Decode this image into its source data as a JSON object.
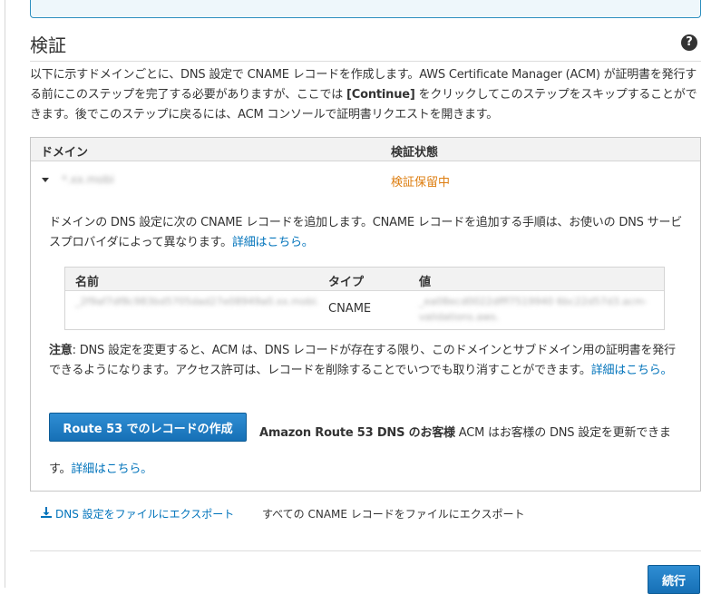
{
  "section": {
    "title": "検証",
    "help_icon": "question-circle-icon",
    "intro_part1": "以下に示すドメインごとに、DNS 設定で CNAME レコードを作成します。AWS Certificate Manager (ACM) が証明書を発行する前にこのステップを完了する必要がありますが、ここでは ",
    "intro_bold": "[Continue]",
    "intro_part2": " をクリックしてこのステップをスキップすることができます。後でこのステップに戻るには、ACM コンソールで証明書リクエストを開きます。"
  },
  "domain_table": {
    "header_domain": "ドメイン",
    "header_status": "検証状態",
    "row": {
      "domain": "*.xx.mobi",
      "status": "検証保留中"
    },
    "detail_text": "ドメインの DNS 設定に次の CNAME レコードを追加します。CNAME レコードを追加する手順は、お使いの DNS サービスプロバイダによって異なります。",
    "detail_link": "詳細はこちら。"
  },
  "record_table": {
    "header_name": "名前",
    "header_type": "タイプ",
    "header_value": "値",
    "row": {
      "name": "_2f9af7df8c983bd5705dad27e08949a0.xx.mobi.",
      "type": "CNAME",
      "value": "_ea08ecd0022dfff7519940 6bc22d57d3.acm-validations.aws."
    }
  },
  "note": {
    "label": "注意",
    "text": ": DNS 設定を変更すると、ACM は、DNS レコードが存在する限り、このドメインとサブドメイン用の証明書を発行できるようになります。アクセス許可は、レコードを削除することでいつでも取り消すことができます。",
    "link": "詳細はこちら。"
  },
  "route53": {
    "button_label": "Route 53 でのレコードの作成",
    "bold_text": "Amazon Route 53 DNS のお客様",
    "text": " ACM はお客様の DNS 設定を更新できます。",
    "link": "詳細はこちら。"
  },
  "export": {
    "icon": "download-icon",
    "dns_link": "DNS 設定をファイルにエクスポート",
    "all_text": "すべての CNAME レコードをファイルにエクスポート"
  },
  "footer": {
    "continue_label": "続行"
  },
  "colors": {
    "link": "#0073bb",
    "pending": "#dd7d0f",
    "primary_button": "#1f7fc4"
  }
}
